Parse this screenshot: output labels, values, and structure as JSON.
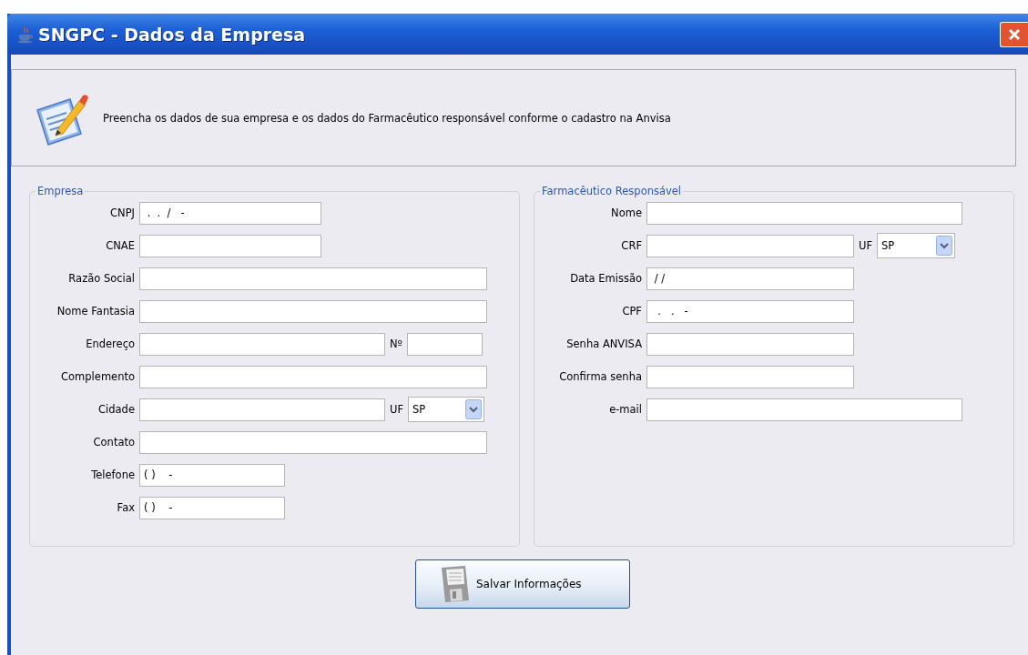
{
  "window": {
    "title": "SNGPC - Dados da Empresa"
  },
  "header": {
    "text": "Preencha os dados de sua empresa e os dados do Farmacêutico responsável conforme o cadastro na Anvisa"
  },
  "panels": [
    {
      "title": "Empresa",
      "rows": [
        {
          "label": "CNPJ",
          "kind": "short",
          "value": " .  .  /   -"
        },
        {
          "label": "CNAE",
          "kind": "short",
          "value": ""
        },
        {
          "label": "Razão Social",
          "kind": "wide",
          "value": ""
        },
        {
          "label": "Nome Fantasia",
          "kind": "wide",
          "value": ""
        },
        {
          "label": "Endereço",
          "kind": "pair",
          "value": "",
          "extra_label": "Nº",
          "extra_value": ""
        },
        {
          "label": "Complemento",
          "kind": "wide",
          "value": ""
        },
        {
          "label": "Cidade",
          "kind": "select",
          "value": "",
          "extra_label": "UF",
          "extra_value": "SP"
        },
        {
          "label": "Contato",
          "kind": "wide",
          "value": ""
        },
        {
          "label": "Telefone",
          "kind": "small",
          "value": "( )    -"
        },
        {
          "label": "Fax",
          "kind": "small",
          "value": "( )    -"
        }
      ]
    },
    {
      "title": "Farmacêutico Responsável",
      "rows": [
        {
          "label": "Nome",
          "kind": "wide",
          "value": ""
        },
        {
          "label": "CRF",
          "kind": "select",
          "value": "",
          "extra_label": "UF",
          "extra_value": "SP"
        },
        {
          "label": "Data Emissão",
          "kind": "medium",
          "value": " / /"
        },
        {
          "label": "CPF",
          "kind": "medium",
          "value": "  .   .   -"
        },
        {
          "label": "Senha ANVISA",
          "kind": "medium",
          "value": ""
        },
        {
          "label": "Confirma senha",
          "kind": "medium",
          "value": ""
        },
        {
          "label": "e-mail",
          "kind": "wide",
          "value": ""
        }
      ]
    }
  ],
  "save_button": {
    "label": "Salvar Informações"
  }
}
